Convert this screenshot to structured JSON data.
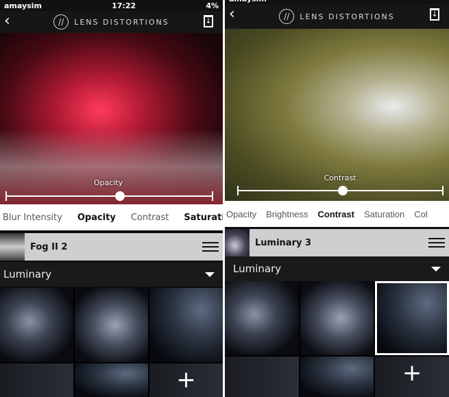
{
  "left": {
    "status": {
      "carrier": "amaysim",
      "time": "17:22",
      "battery": "4%"
    },
    "nav": {
      "brand": "LENS DISTORTIONS",
      "back_icon": "chevron-left-icon",
      "download_icon": "download-icon"
    },
    "slider": {
      "label": "Opacity",
      "value": 0.55
    },
    "tabs": [
      {
        "label": "Blur Intensity",
        "active": false
      },
      {
        "label": "Opacity",
        "active": true
      },
      {
        "label": "Contrast",
        "active": false
      },
      {
        "label": "Saturation",
        "active": false
      }
    ],
    "layer": {
      "name": "Fog II 2"
    },
    "category": {
      "label": "Luminary"
    }
  },
  "right": {
    "status": {
      "carrier": "amaysim"
    },
    "nav": {
      "brand": "LENS DISTORTIONS",
      "back_icon": "chevron-left-icon",
      "download_icon": "download-icon"
    },
    "slider": {
      "label": "Contrast",
      "value": 0.51
    },
    "tabs": [
      {
        "label": "Opacity",
        "active": false
      },
      {
        "label": "Brightness",
        "active": false
      },
      {
        "label": "Contrast",
        "active": true
      },
      {
        "label": "Saturation",
        "active": false
      },
      {
        "label": "Col",
        "active": false
      }
    ],
    "layer": {
      "name": "Luminary 3"
    },
    "category": {
      "label": "Luminary"
    },
    "selected_tile": 3
  },
  "colors": {
    "accent": "#ffffff",
    "nav_bg": "#161616",
    "layer_bg": "#cfcfcf"
  }
}
